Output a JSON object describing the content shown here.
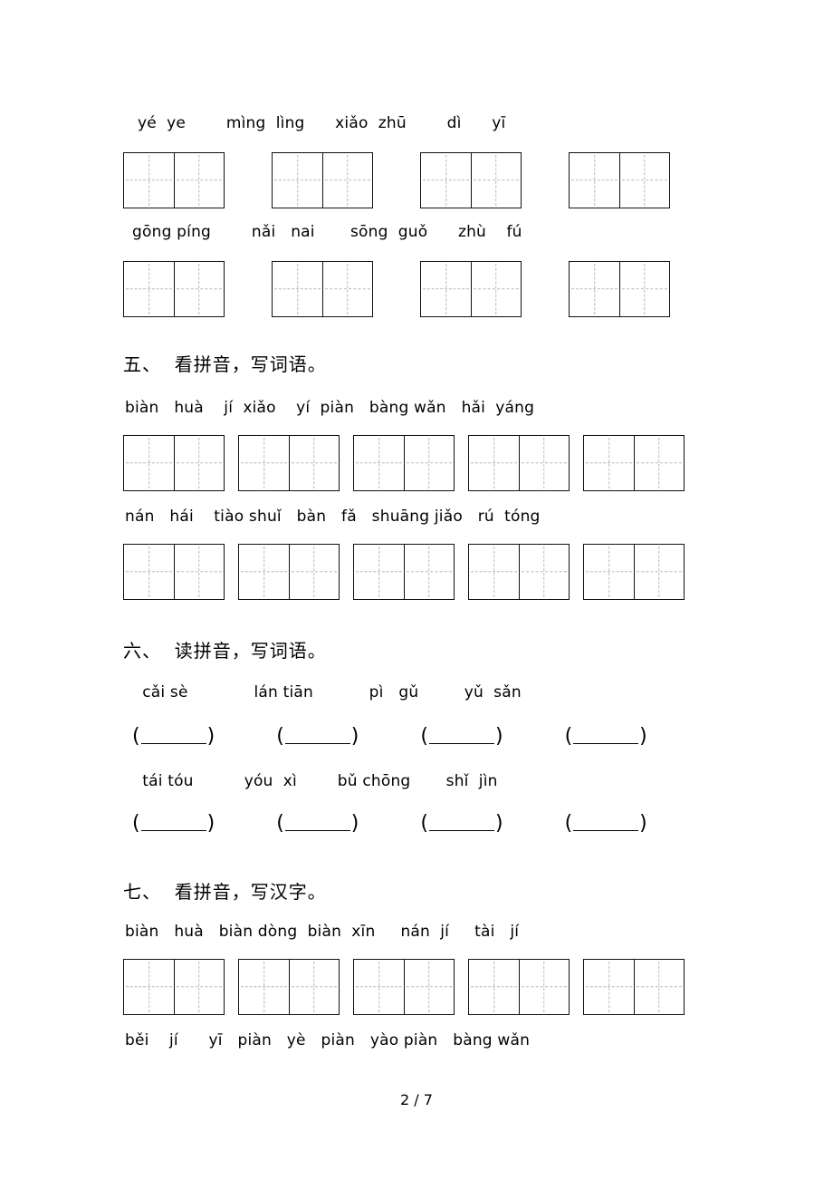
{
  "document": {
    "page_footer": "2 / 7"
  },
  "sections": [
    {
      "id": "section-continued",
      "heading": "",
      "rows": [
        {
          "pinyin": "yé  ye        mìng  lìng      xiǎo  zhū        dì      yī",
          "boxes": 4,
          "cells_per_box": 2
        },
        {
          "pinyin": "gōng píng        nǎi   nai       sōng  guǒ      zhù    fú",
          "boxes": 4,
          "cells_per_box": 2
        }
      ]
    },
    {
      "id": "section-five",
      "heading": "五、  看拼音，写词语。",
      "rows": [
        {
          "pinyin": "biàn   huà    jí  xiǎo    yí  piàn   bàng wǎn   hǎi  yáng",
          "boxes": 5,
          "cells_per_box": 2
        },
        {
          "pinyin": "nán   hái    tiào shuǐ   bàn   fǎ   shuāng jiǎo   rú  tóng",
          "boxes": 5,
          "cells_per_box": 2
        }
      ]
    },
    {
      "id": "section-six",
      "heading": "六、  读拼音，写词语。",
      "rows": [
        {
          "pinyin": "  cǎi sè             lán tiān           pì   gǔ         yǔ  sǎn",
          "blanks": 4
        },
        {
          "pinyin": "  tái tóu          yóu  xì        bǔ chōng       shǐ  jìn",
          "blanks": 4
        }
      ]
    },
    {
      "id": "section-seven",
      "heading": "七、  看拼音，写汉字。",
      "rows": [
        {
          "pinyin": "biàn   huà   biàn dòng  biàn  xīn     nán  jí     tài   jí",
          "boxes": 5,
          "cells_per_box": 2
        },
        {
          "pinyin": "běi    jí      yī   piàn   yè   piàn   yào piàn   bàng wǎn",
          "boxes": 0,
          "cells_per_box": 2
        }
      ]
    }
  ],
  "colors": {
    "page_background": "#ffffff",
    "text": "#000000",
    "box_border": "#111111",
    "guide_line": "#b9b9b9"
  }
}
